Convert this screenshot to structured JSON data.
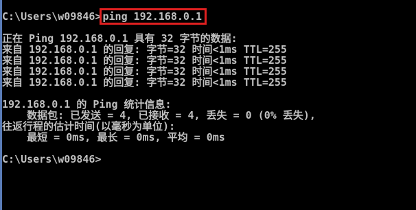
{
  "console": {
    "prompt_line": {
      "prompt": "C:\\Users\\w09846>",
      "command": "ping 192.168.0.1"
    },
    "ping_header": "正在 Ping 192.168.0.1 具有 32 字节的数据:",
    "replies": [
      "来自 192.168.0.1 的回复: 字节=32 时间<1ms TTL=255",
      "来自 192.168.0.1 的回复: 字节=32 时间<1ms TTL=255",
      "来自 192.168.0.1 的回复: 字节=32 时间<1ms TTL=255",
      "来自 192.168.0.1 的回复: 字节=32 时间<1ms TTL=255"
    ],
    "stats_header": "192.168.0.1 的 Ping 统计信息:",
    "packets_line": "    数据包: 已发送 = 4, 已接收 = 4, 丢失 = 0 (0% 丢失),",
    "rtt_header": "往返行程的估计时间(以毫秒为单位):",
    "rtt_values": "    最短 = 0ms, 最长 = 0ms, 平均 = 0ms",
    "final_prompt": "C:\\Users\\w09846>"
  },
  "colors": {
    "background": "#000000",
    "text": "#c0c0c0",
    "highlight_border": "#e02020"
  }
}
